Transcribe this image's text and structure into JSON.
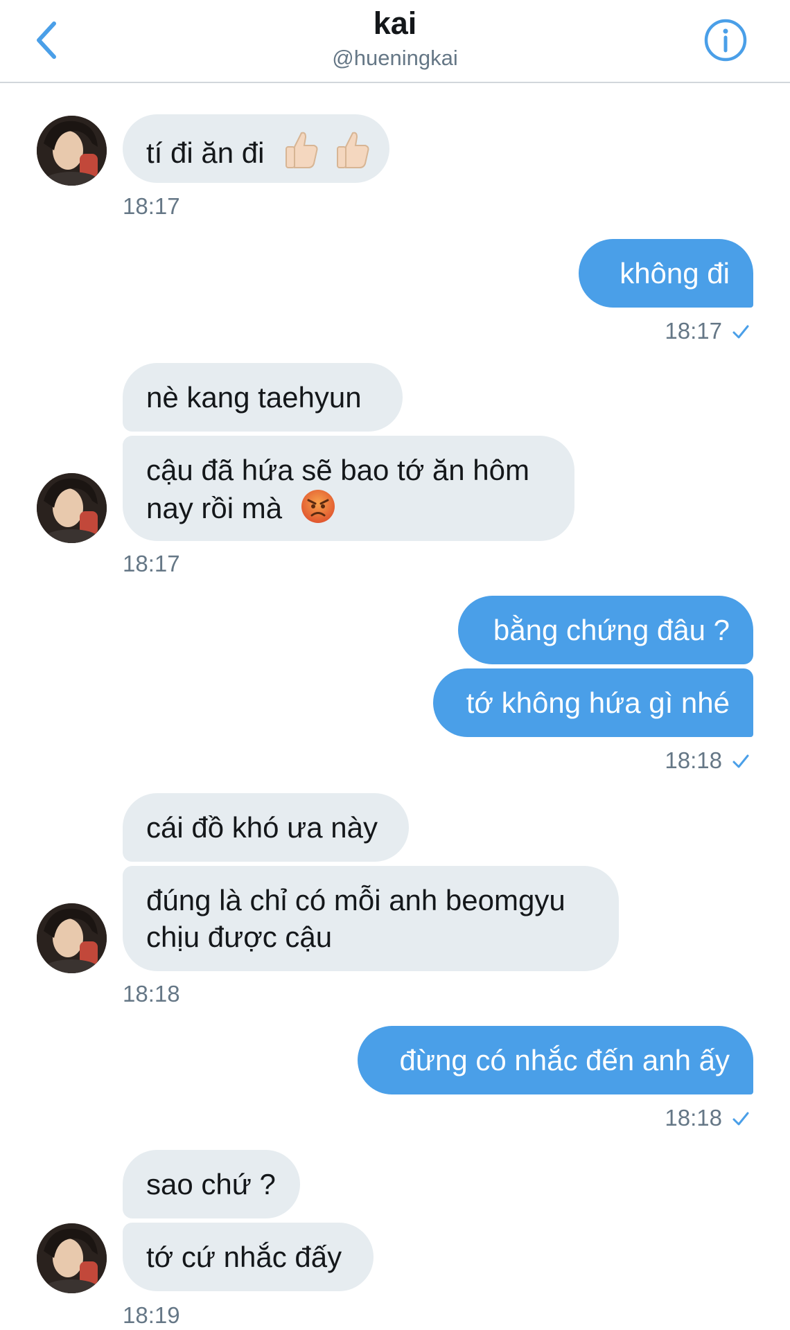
{
  "header": {
    "title": "kai",
    "handle": "@hueningkai",
    "back_icon": "chevron-left-icon",
    "info_icon": "info-icon",
    "accent_color": "#4a9fe8"
  },
  "colors": {
    "incoming_bubble": "#e6ecf0",
    "outgoing_bubble": "#4a9fe8",
    "timestamp": "#657786"
  },
  "messages": {
    "m1": {
      "text": "tí đi ăn đi",
      "emoji": [
        "thumbs-up-light-skin",
        "thumbs-up-light-skin"
      ]
    },
    "t1": "18:17",
    "m2": {
      "text": "không đi"
    },
    "t2": "18:17",
    "m3": {
      "text": "nè kang taehyun"
    },
    "m4": {
      "line1": "cậu đã hứa sẽ bao tớ ăn hôm",
      "line2": "nay rồi mà",
      "emoji": [
        "angry-face"
      ]
    },
    "t3": "18:17",
    "m5": {
      "text": "bằng chứng đâu ?"
    },
    "m6": {
      "text": "tớ không hứa gì nhé"
    },
    "t4": "18:18",
    "m7": {
      "text": "cái đồ khó ưa này"
    },
    "m8": {
      "line1": "đúng là chỉ có mỗi anh beomgyu",
      "line2": "chịu được cậu"
    },
    "t5": "18:18",
    "m9": {
      "text": "đừng có nhắc đến anh ấy"
    },
    "t6": "18:18",
    "m10": {
      "text": "sao chứ ?"
    },
    "m11": {
      "text": "tớ cứ nhắc đấy"
    },
    "t7": "18:19"
  }
}
